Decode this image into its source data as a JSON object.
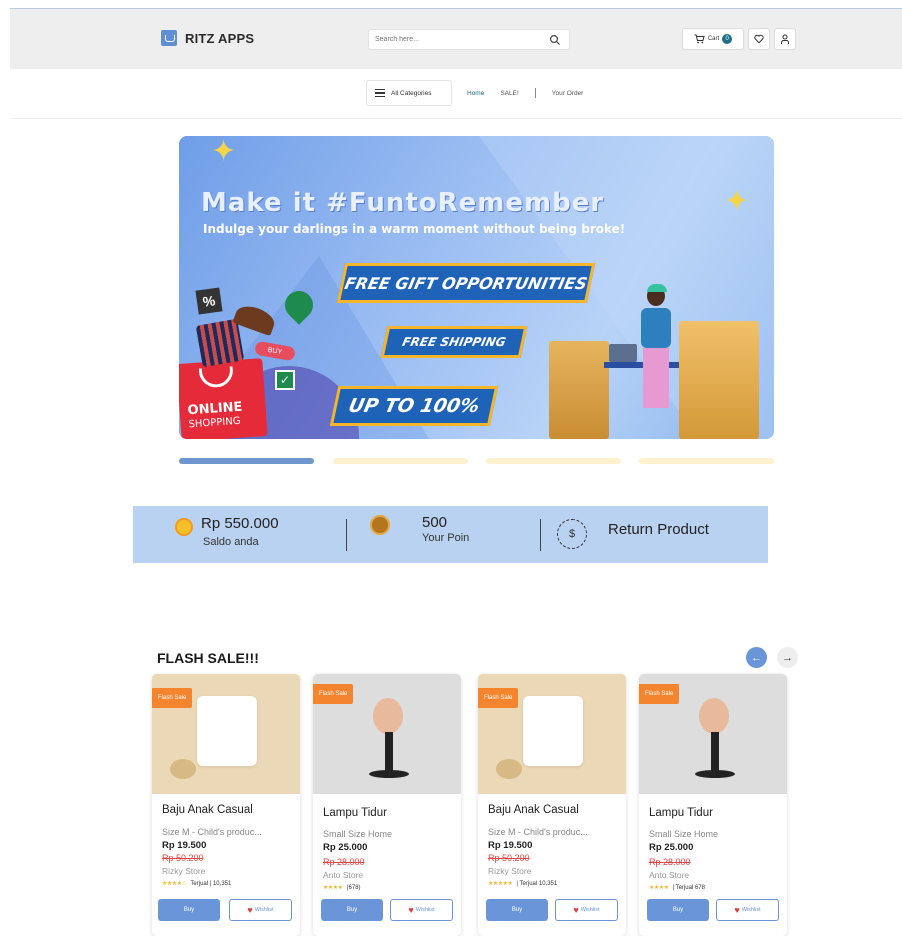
{
  "header": {
    "logo_text": "RITZ APPS",
    "search_placeholder": "Search here...",
    "cart_label": "Cart",
    "cart_count": "0"
  },
  "nav": {
    "categories_label": "All Categories",
    "links": [
      "Home",
      "SALE!",
      "Your Order"
    ]
  },
  "banner": {
    "title": "Make it #FuntoRemember",
    "subtitle": "Indulge your darlings in a warm moment without being broke!",
    "ribbon_1": "FREE GIFT OPPORTUNITIES",
    "ribbon_2": "FREE SHIPPING",
    "ribbon_3": "UP TO 100%",
    "bag_text_1": "ONLINE",
    "bag_text_2": "SHOPPING",
    "tag_buy": "BUY",
    "tag_percent": "%"
  },
  "wallet": {
    "balance": "Rp 550.000",
    "balance_label": "Saldo anda",
    "points": "500",
    "points_label": "Your Poin",
    "return_label": "Return Product"
  },
  "flash_sale": {
    "title": "FLASH SALE!!!",
    "products": [
      {
        "tag": "Flash Sale",
        "name": "Baju Anak Casual",
        "desc": "Size M - Child's produc...",
        "price": "Rp 19.500",
        "old_price": "Rp 50.200",
        "store": "Rizky Store",
        "stars": "★★★★☆",
        "rating_text": "Terjual | 10,351",
        "buy_label": "Buy",
        "wish_label": "Wishlist"
      },
      {
        "tag": "Flash Sale",
        "name": "Lampu Tidur",
        "desc": "Small Size Home",
        "price": "Rp 25.000",
        "old_price": "Rp 28.000",
        "store": "Anto Store",
        "stars": "★★★★",
        "rating_text": "(678)",
        "buy_label": "Buy",
        "wish_label": "Wishlist"
      },
      {
        "tag": "Flash Sale",
        "name": "Baju Anak Casual",
        "desc": "Size M - Child's produc...",
        "price": "Rp 19.500",
        "old_price": "Rp 50.200",
        "store": "Rizky Store",
        "stars": "★★★★★",
        "rating_text": "| Terjual 10,351",
        "buy_label": "Buy",
        "wish_label": "Wishlist"
      },
      {
        "tag": "Flash Sale",
        "name": "Lampu Tidur",
        "desc": "Small Size Home",
        "price": "Rp 25.000",
        "old_price": "Rp 28.000",
        "store": "Anto Store",
        "stars": "★★★★",
        "rating_text": "| Terjual 678",
        "buy_label": "Buy",
        "wish_label": "Wishlist"
      }
    ]
  },
  "colors": {
    "accent": "#6a95d9",
    "flash_tag": "#f5842e",
    "wallet_bg": "#b9d2f1",
    "old_price": "#e34545"
  }
}
